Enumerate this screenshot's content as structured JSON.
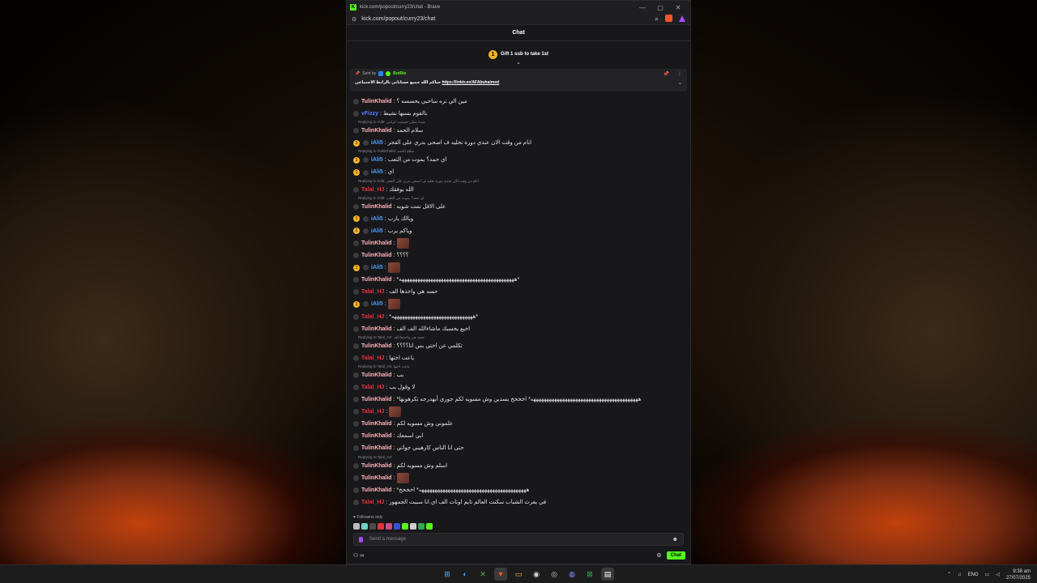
{
  "browser": {
    "title": "kick.com/popout/curry23/chat - Brave",
    "url": "kick.com/popout/curry23/chat"
  },
  "chat": {
    "header": "Chat",
    "gift_count": "1",
    "gift_text": "Gift 1 sub to take 1st",
    "pinned": {
      "sent_by_label": "Sent by",
      "sent_by_user": "BotRix",
      "text": "حياكم الله جميع حساباتي بالرابط الاجتماعي",
      "link": "https://linktr.ee/AFAbuhaimed"
    },
    "messages": [
      {
        "type": "msg",
        "user": "TulinKhalid",
        "color": "#ffb3ba",
        "text": "مين الي تره ساحبي يحسسه ؟"
      },
      {
        "type": "msg",
        "user": "vFizzy",
        "color": "#4f7fff",
        "text": "بالقوم بسبها نشيط"
      },
      {
        "type": "reply",
        "text": "Replying to iAli5: شدة يمكن حسنيت كرامي"
      },
      {
        "type": "msg",
        "user": "TulinKhalid",
        "color": "#ffb3ba",
        "text": "سلام الحمد"
      },
      {
        "type": "msg",
        "badge": "1",
        "user": "iAli5",
        "color": "#4f9dff",
        "text": "انام من وقت الان عندي دورة تحليد ف اصحى بدري على الفجر"
      },
      {
        "type": "reply",
        "text": "Replying to TulinKhalid: سلام الحمد"
      },
      {
        "type": "msg",
        "badge": "1",
        "user": "iAli5",
        "color": "#4f9dff",
        "text": "اي حمد؟ يموت من التعب"
      },
      {
        "type": "msg",
        "badge": "1",
        "user": "iAli5",
        "color": "#4f9dff",
        "text": "اي"
      },
      {
        "type": "reply",
        "text": "Replying to iAli5: انام من وقت الان عندي دورة تحليد ف اصحى بدري على الفجر"
      },
      {
        "type": "msg",
        "user": "Talal_HJ",
        "color": "#e0343d",
        "text": "الله يوفقك"
      },
      {
        "type": "reply",
        "text": "Replying to iAli5: اي حمد؟ يموت من التعب"
      },
      {
        "type": "msg",
        "user": "TulinKhalid",
        "color": "#ffb3ba",
        "text": "على الاقل نمت شويه"
      },
      {
        "type": "msg",
        "badge": "1",
        "user": "iAli5",
        "color": "#4f9dff",
        "text": "ويالك يارب"
      },
      {
        "type": "msg",
        "badge": "1",
        "user": "iAli5",
        "color": "#4f9dff",
        "text": "وياكم يرب"
      },
      {
        "type": "msg",
        "user": "TulinKhalid",
        "color": "#ffb3ba",
        "text": "",
        "emote": true
      },
      {
        "type": "msg",
        "user": "TulinKhalid",
        "color": "#ffb3ba",
        "text": "؟؟؟؟"
      },
      {
        "type": "msg",
        "badge": "1",
        "user": "iAli5",
        "color": "#4f9dff",
        "text": "",
        "emote": true
      },
      {
        "type": "msg",
        "user": "TulinKhalid",
        "color": "#ffb3ba",
        "text": "*ههههههههههههههههههههههههههههههههههههههههههههه*"
      },
      {
        "type": "msg",
        "user": "Talal_HJ",
        "color": "#e0343d",
        "text": "حسد هي واخذها الف"
      },
      {
        "type": "msg",
        "badge": "1",
        "user": "iAli5",
        "color": "#4f9dff",
        "text": "",
        "emote": true
      },
      {
        "type": "msg",
        "user": "Talal_HJ",
        "color": "#e0343d",
        "text": "*هههههههههههههههههههههههههههههههه*"
      },
      {
        "type": "msg",
        "user": "TulinKhalid",
        "color": "#ffb3ba",
        "text": "اخيع يحسبك ماشاءالله الف الف"
      },
      {
        "type": "reply",
        "text": "Replying to Talal_HJ: حسد هي واخذها الف"
      },
      {
        "type": "msg",
        "user": "TulinKhalid",
        "color": "#ffb3ba",
        "text": "تكلمي عن اختي بس انا؟؟؟؟"
      },
      {
        "type": "msg",
        "user": "Talal_HJ",
        "color": "#e0343d",
        "text": "ياعت اختها"
      },
      {
        "type": "reply",
        "text": "Replying to Talal_HJ: ياعت اختها"
      },
      {
        "type": "msg",
        "user": "TulinKhalid",
        "color": "#ffb3ba",
        "text": "بب"
      },
      {
        "type": "msg",
        "user": "Talal_HJ",
        "color": "#e0343d",
        "text": "لا وقول بب"
      },
      {
        "type": "msg",
        "user": "TulinKhalid",
        "color": "#ffb3ba",
        "text": "*هههههههههههههههههههههههههههههههههههههههههه* اخخخخ يسدين وش مسويه لكم جوري أبهدرجه تكرهونها"
      },
      {
        "type": "msg",
        "user": "Talal_HJ",
        "color": "#e0343d",
        "text": "",
        "emote": true
      },
      {
        "type": "msg",
        "user": "TulinKhalid",
        "color": "#ffb3ba",
        "text": "علموني وش مسويه لكم"
      },
      {
        "type": "msg",
        "user": "TulinKhalid",
        "color": "#ffb3ba",
        "text": "ابي اسمعك"
      },
      {
        "type": "msg",
        "user": "TulinKhalid",
        "color": "#ffb3ba",
        "text": "حتى انا الناس كارهيني جواتي"
      },
      {
        "type": "reply",
        "text": "Replying to Talal_HJ:"
      },
      {
        "type": "msg",
        "user": "TulinKhalid",
        "color": "#ffb3ba",
        "text": "اسلم وش مسويه لكم"
      },
      {
        "type": "msg",
        "user": "TulinKhalid",
        "color": "#ffb3ba",
        "text": "",
        "emote": true
      },
      {
        "type": "msg",
        "user": "TulinKhalid",
        "color": "#ffb3ba",
        "text": "*هههههههههههههههههههههههههههههههههههههههههه* اخخخخ"
      },
      {
        "type": "msg",
        "user": "Talal_HJ",
        "color": "#e0343d",
        "text": "في يغرث الشباب سكنت العالم تايم اوتات الف اي انا سببت الجمهور"
      }
    ],
    "followers_only": "Followers only",
    "input_placeholder": "Send a message",
    "send_label": "Chat"
  },
  "taskbar": {
    "language": "ENG",
    "time": "9:38 am",
    "date": "27/07/2025"
  },
  "colors": {
    "kick_green": "#53fc18",
    "panel": "#18181b",
    "sub_badge": "#f5b323"
  }
}
